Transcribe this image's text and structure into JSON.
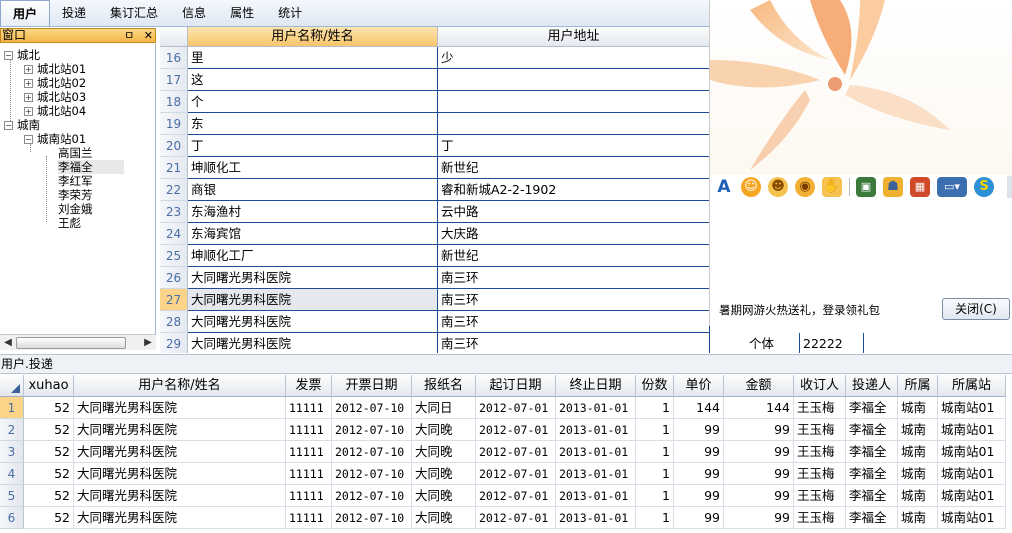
{
  "menu": [
    "用户",
    "投递",
    "集订汇总",
    "信息",
    "属性",
    "统计"
  ],
  "dock": {
    "title": "窗口",
    "pin": "ㅁ",
    "close": "✕"
  },
  "tree": {
    "north": "城北",
    "north_children": [
      "城北站01",
      "城北站02",
      "城北站03",
      "城北站04"
    ],
    "south": "城南",
    "south_station": "城南站01",
    "south_people": [
      "高国兰",
      "李福全",
      "李红军",
      "李荣芳",
      "刘金娥",
      "王彪"
    ]
  },
  "upper_grid": {
    "headers": [
      "用户名称/姓名",
      "用户地址"
    ],
    "rows": [
      {
        "n": "16",
        "name": "里",
        "addr": "少"
      },
      {
        "n": "17",
        "name": "这",
        "addr": ""
      },
      {
        "n": "18",
        "name": "个",
        "addr": ""
      },
      {
        "n": "19",
        "name": "东",
        "addr": ""
      },
      {
        "n": "20",
        "name": "丁",
        "addr": "丁"
      },
      {
        "n": "21",
        "name": "坤顺化工",
        "addr": "新世纪"
      },
      {
        "n": "22",
        "name": "商银",
        "addr": "睿和新城A2-2-1902"
      },
      {
        "n": "23",
        "name": "东海渔村",
        "addr": "云中路"
      },
      {
        "n": "24",
        "name": "东海宾馆",
        "addr": "大庆路"
      },
      {
        "n": "25",
        "name": "坤顺化工厂",
        "addr": "新世纪"
      },
      {
        "n": "26",
        "name": "大同曙光男科医院",
        "addr": "南三环"
      },
      {
        "n": "27",
        "name": "大同曙光男科医院",
        "addr": "南三环"
      },
      {
        "n": "28",
        "name": "大同曙光男科医院",
        "addr": "南三环"
      },
      {
        "n": "29",
        "name": "大同曙光男科医院",
        "addr": "南三环",
        "type": "个体",
        "code": "22222"
      }
    ]
  },
  "popup": {
    "promo": "暑期网游火热送礼，登录领礼包",
    "close": "关闭(C)",
    "icons": [
      "font-icon",
      "smile-icon",
      "emoji-icon",
      "face-icon",
      "hand-icon",
      "image-icon",
      "person-icon",
      "gift-icon",
      "screen-icon",
      "s-icon"
    ],
    "colors": {
      "font": "#1f5fb8",
      "emoji": "#f5a623",
      "image": "#3b7a3b",
      "gift": "#d04a2a",
      "screen": "#3c6fb0"
    }
  },
  "section_label": "用户.投递",
  "lower_grid": {
    "headers": [
      "xuhao",
      "用户名称/姓名",
      "发票",
      "开票日期",
      "报纸名",
      "起订日期",
      "终止日期",
      "份数",
      "单价",
      "金额",
      "收订人",
      "投递人",
      "所属",
      "所属站"
    ],
    "rows": [
      [
        "1",
        "52",
        "大同曙光男科医院",
        "11111",
        "2012-07-10",
        "大同日",
        "2012-07-01",
        "2013-01-01",
        "1",
        "144",
        "144",
        "王玉梅",
        "李福全",
        "城南",
        "城南站01"
      ],
      [
        "2",
        "52",
        "大同曙光男科医院",
        "11111",
        "2012-07-10",
        "大同晚",
        "2012-07-01",
        "2013-01-01",
        "1",
        "99",
        "99",
        "王玉梅",
        "李福全",
        "城南",
        "城南站01"
      ],
      [
        "3",
        "52",
        "大同曙光男科医院",
        "11111",
        "2012-07-10",
        "大同晚",
        "2012-07-01",
        "2013-01-01",
        "1",
        "99",
        "99",
        "王玉梅",
        "李福全",
        "城南",
        "城南站01"
      ],
      [
        "4",
        "52",
        "大同曙光男科医院",
        "11111",
        "2012-07-10",
        "大同晚",
        "2012-07-01",
        "2013-01-01",
        "1",
        "99",
        "99",
        "王玉梅",
        "李福全",
        "城南",
        "城南站01"
      ],
      [
        "5",
        "52",
        "大同曙光男科医院",
        "11111",
        "2012-07-10",
        "大同晚",
        "2012-07-01",
        "2013-01-01",
        "1",
        "99",
        "99",
        "王玉梅",
        "李福全",
        "城南",
        "城南站01"
      ],
      [
        "6",
        "52",
        "大同曙光男科医院",
        "11111",
        "2012-07-10",
        "大同晚",
        "2012-07-01",
        "2013-01-01",
        "1",
        "99",
        "99",
        "王玉梅",
        "李福全",
        "城南",
        "城南站01"
      ]
    ]
  }
}
